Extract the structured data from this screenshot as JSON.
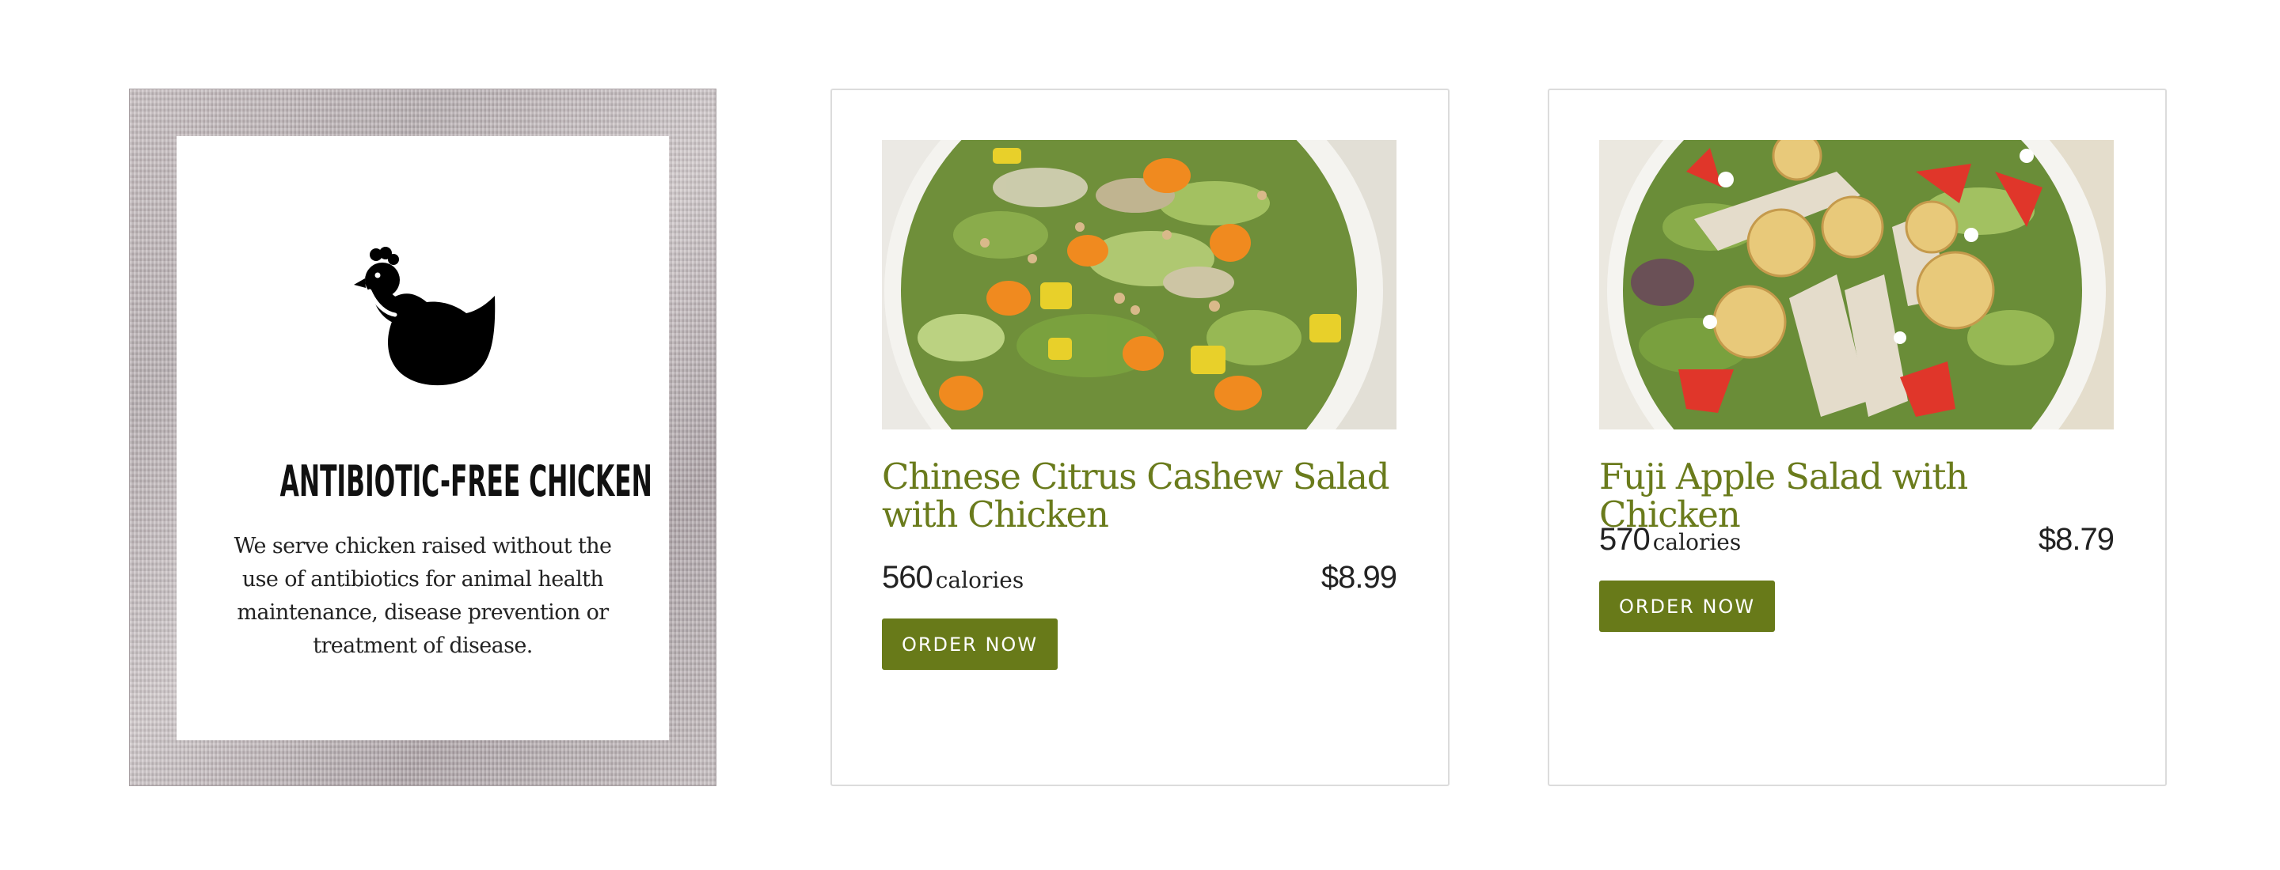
{
  "promo": {
    "title": "ANTIBIOTIC-FREE CHICKEN",
    "text": "We serve chicken raised without the use of antibiotics for animal health maintenance, disease prevention or treatment of disease.",
    "icon": "chicken-icon"
  },
  "products": [
    {
      "name": "Chinese Citrus Cashew Salad with Chicken",
      "calories": "560",
      "calories_label": "calories",
      "price": "$8.99",
      "button_label": "ORDER NOW"
    },
    {
      "name": "Fuji Apple Salad with Chicken",
      "calories": "570",
      "calories_label": "calories",
      "price": "$8.79",
      "button_label": "ORDER NOW"
    }
  ],
  "colors": {
    "accent": "#687a19",
    "product_name": "#6a7b1c",
    "text": "#222222",
    "card_border": "#dcdcdc"
  }
}
